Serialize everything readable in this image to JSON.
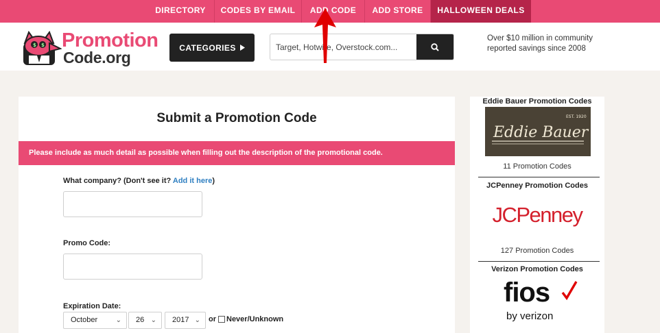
{
  "topnav": {
    "items": [
      {
        "label": "DIRECTORY"
      },
      {
        "label": "CODES BY EMAIL"
      },
      {
        "label": "ADD CODE"
      },
      {
        "label": "ADD STORE"
      },
      {
        "label": "HALLOWEEN DEALS"
      }
    ]
  },
  "header": {
    "logo_word1": "Promotion",
    "logo_word2": "Code.org",
    "categories_label": "CATEGORIES",
    "search_placeholder": "Target, Hotwire, Overstock.com...",
    "tagline": "Over $10 million in community reported savings since 2008"
  },
  "form": {
    "title": "Submit a Promotion Code",
    "notice": "Please include as much detail as possible when filling out the description of the promotional code.",
    "company_label": "What company? (Don't see it? ",
    "company_link": "Add it here",
    "company_label_end": ")",
    "promo_label": "Promo Code:",
    "expiration_label": "Expiration Date:",
    "month": "October",
    "day": "26",
    "year": "2017",
    "or_text": "or",
    "never_label": "Never/Unknown"
  },
  "sidebar": {
    "stores": [
      {
        "title": "Eddie Bauer Promotion Codes",
        "logo": "Eddie Bauer",
        "logo_small": "EST. 1920",
        "count": "11 Promotion Codes"
      },
      {
        "title": "JCPenney Promotion Codes",
        "logo": "JCPenney",
        "count": "127 Promotion Codes"
      },
      {
        "title": "Verizon Promotion Codes",
        "logo": "fios",
        "logo_sub": "by verizon"
      }
    ]
  },
  "colors": {
    "brand_pink": "#e94a74",
    "highlight": "#b5244a",
    "dark": "#222222",
    "link": "#2f7fc1",
    "jcp_red": "#d4202c",
    "verizon_red": "#e00000"
  }
}
